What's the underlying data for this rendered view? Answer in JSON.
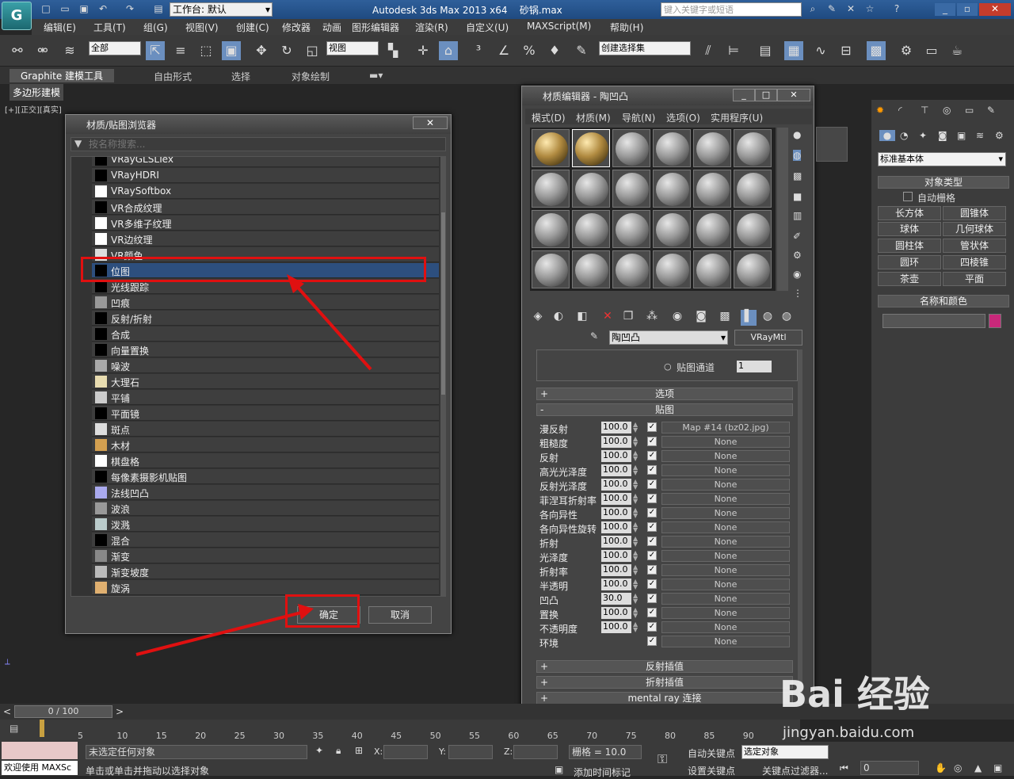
{
  "app": {
    "title": "Autodesk 3ds Max  2013 x64",
    "file": "砂锅.max",
    "workspace": "工作台: 默认",
    "search_placeholder": "键入关键字或短语"
  },
  "menu": [
    "编辑(E)",
    "工具(T)",
    "组(G)",
    "视图(V)",
    "创建(C)",
    "修改器",
    "动画",
    "图形编辑器",
    "渲染(R)",
    "自定义(U)",
    "MAXScript(M)",
    "帮助(H)"
  ],
  "toolbar": {
    "filter": "全部",
    "refcoord": "视图",
    "selset": "创建选择集"
  },
  "ribbon": {
    "tabs": [
      "Graphite 建模工具",
      "自由形式",
      "选择",
      "对象绘制"
    ],
    "sub": "多边形建模"
  },
  "viewport": {
    "label": "[+][正交][真实]"
  },
  "browser": {
    "title": "材质/贴图浏览器",
    "search_placeholder": "按名称搜索...",
    "items": [
      {
        "label": "VRayGLSLTex",
        "swatch": "#000000"
      },
      {
        "label": "VRayHDRI",
        "swatch": "#000000"
      },
      {
        "label": "VRaySoftbox",
        "swatch": "#ffffff"
      },
      {
        "label": "VR合成纹理",
        "swatch": "#000000"
      },
      {
        "label": "VR多维子纹理",
        "swatch": "#ffffff"
      },
      {
        "label": "VR边纹理",
        "swatch": "#ffffff"
      },
      {
        "label": "VR颜色",
        "swatch": "#dddddd"
      },
      {
        "label": "位图",
        "swatch": "#000000"
      },
      {
        "label": "光线跟踪",
        "swatch": "#000000"
      },
      {
        "label": "凹痕",
        "swatch": "#999999"
      },
      {
        "label": "反射/折射",
        "swatch": "#000000"
      },
      {
        "label": "合成",
        "swatch": "#000000"
      },
      {
        "label": "向量置换",
        "swatch": "#000000"
      },
      {
        "label": "噪波",
        "swatch": "#aaaaaa"
      },
      {
        "label": "大理石",
        "swatch": "#e8dcb0"
      },
      {
        "label": "平铺",
        "swatch": "#cccccc"
      },
      {
        "label": "平面镜",
        "swatch": "#000000"
      },
      {
        "label": "斑点",
        "swatch": "#dddddd"
      },
      {
        "label": "木材",
        "swatch": "#d4a050"
      },
      {
        "label": "棋盘格",
        "swatch": "#ffffff"
      },
      {
        "label": "每像素摄影机贴图",
        "swatch": "#000000"
      },
      {
        "label": "法线凹凸",
        "swatch": "#aaaaee"
      },
      {
        "label": "波浪",
        "swatch": "#999999"
      },
      {
        "label": "泼溅",
        "swatch": "#bbcccc"
      },
      {
        "label": "混合",
        "swatch": "#000000"
      },
      {
        "label": "渐变",
        "swatch": "#888888"
      },
      {
        "label": "渐变坡度",
        "swatch": "#bbbbbb"
      },
      {
        "label": "旋涡",
        "swatch": "#e0b070"
      }
    ],
    "ok": "确定",
    "cancel": "取消"
  },
  "mated": {
    "title": "材质编辑器 - 陶凹凸",
    "menu": [
      "模式(D)",
      "材质(M)",
      "导航(N)",
      "选项(O)",
      "实用程序(U)"
    ],
    "name": "陶凹凸",
    "type": "VRayMtl",
    "mapchannel": "贴图通道",
    "mapchannel_val": "1",
    "rollouts": {
      "options": "选项",
      "maps": "贴图",
      "reflinterp": "反射插值",
      "refrinterp": "折射插值",
      "mentalray": "mental ray 连接"
    },
    "maps": [
      {
        "label": "漫反射",
        "val": "100.0",
        "map": "Map #14 (bz02.jpg)"
      },
      {
        "label": "粗糙度",
        "val": "100.0",
        "map": "None"
      },
      {
        "label": "反射",
        "val": "100.0",
        "map": "None"
      },
      {
        "label": "高光光泽度",
        "val": "100.0",
        "map": "None"
      },
      {
        "label": "反射光泽度",
        "val": "100.0",
        "map": "None"
      },
      {
        "label": "菲涅耳折射率",
        "val": "100.0",
        "map": "None"
      },
      {
        "label": "各向异性",
        "val": "100.0",
        "map": "None"
      },
      {
        "label": "各向异性旋转",
        "val": "100.0",
        "map": "None"
      },
      {
        "label": "折射",
        "val": "100.0",
        "map": "None"
      },
      {
        "label": "光泽度",
        "val": "100.0",
        "map": "None"
      },
      {
        "label": "折射率",
        "val": "100.0",
        "map": "None"
      },
      {
        "label": "半透明",
        "val": "100.0",
        "map": "None"
      },
      {
        "label": "凹凸",
        "val": "30.0",
        "map": "None"
      },
      {
        "label": "置换",
        "val": "100.0",
        "map": "None"
      },
      {
        "label": "不透明度",
        "val": "100.0",
        "map": "None"
      },
      {
        "label": "环境",
        "val": "",
        "map": "None"
      }
    ]
  },
  "rightpanel": {
    "category": "标准基本体",
    "objtype": "对象类型",
    "autogrid": "自动栅格",
    "buttons": [
      "长方体",
      "圆锥体",
      "球体",
      "几何球体",
      "圆柱体",
      "管状体",
      "圆环",
      "四棱锥",
      "茶壶",
      "平面"
    ],
    "namecolor": "名称和颜色",
    "color": "#c8287a"
  },
  "timeline": {
    "frame": "0 / 100",
    "ticks": [
      "5",
      "10",
      "15",
      "20",
      "25",
      "30",
      "35",
      "40",
      "45",
      "50",
      "55",
      "60",
      "65",
      "70",
      "75",
      "80",
      "85",
      "90"
    ]
  },
  "status": {
    "welcome": "欢迎使用 MAXSc",
    "sel": "未选定任何对象",
    "hint": "单击或单击并拖动以选择对象",
    "x": "X:",
    "y": "Y:",
    "z": "Z:",
    "grid": "栅格 = 10.0",
    "autokey": "自动关键点",
    "selobj": "选定对象",
    "setkey": "设置关键点",
    "keyfilter": "关键点过滤器...",
    "addtime": "添加时间标记",
    "frameval": "0"
  },
  "watermark": {
    "brand": "Bai 经验",
    "url": "jingyan.baidu.com"
  }
}
